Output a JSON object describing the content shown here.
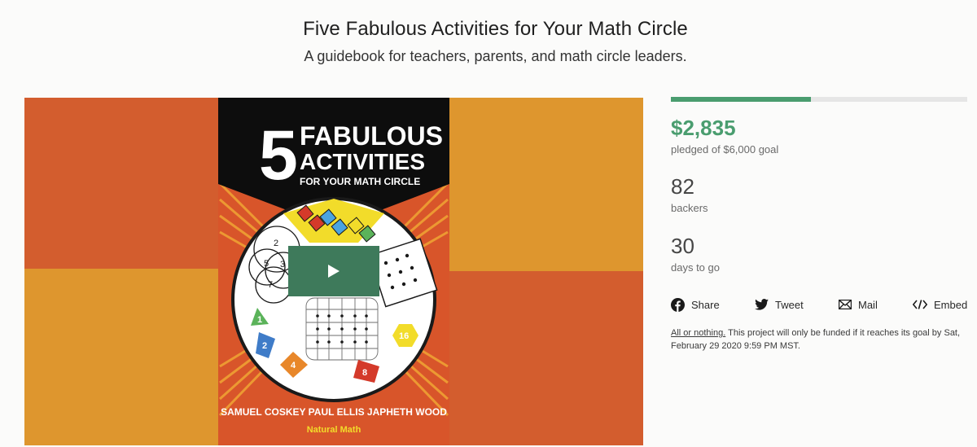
{
  "project": {
    "title": "Five Fabulous Activities for Your Math Circle",
    "subtitle": "A guidebook for teachers, parents, and math circle leaders."
  },
  "video": {
    "cover_number": "5",
    "cover_line1": "FABULOUS",
    "cover_line2": "ACTIVITIES",
    "cover_line3": "FOR YOUR MATH CIRCLE",
    "authors": "SAMUEL COSKEY   PAUL ELLIS   JAPHETH WOOD",
    "publisher": "Natural Math",
    "shape_labels": [
      "1",
      "2",
      "4",
      "8",
      "16"
    ],
    "venn_labels": [
      "2",
      "5",
      "3",
      "7"
    ],
    "colors": {
      "orange": "#d35d2e",
      "gold": "#de962e",
      "black": "#0d0d0d",
      "play": "#3e7a5b"
    }
  },
  "funding": {
    "progress_fraction": 0.4725,
    "pledged": "$2,835",
    "pledged_label": "pledged of $6,000 goal",
    "backers": "82",
    "backers_label": "backers",
    "days": "30",
    "days_label": "days to go",
    "accent_color": "#4a9d6f"
  },
  "share": {
    "facebook": "Share",
    "twitter": "Tweet",
    "mail": "Mail",
    "embed": "Embed"
  },
  "notice": {
    "link": "All or nothing.",
    "text": " This project will only be funded if it reaches its goal by Sat, February 29 2020 9:59 PM MST."
  }
}
